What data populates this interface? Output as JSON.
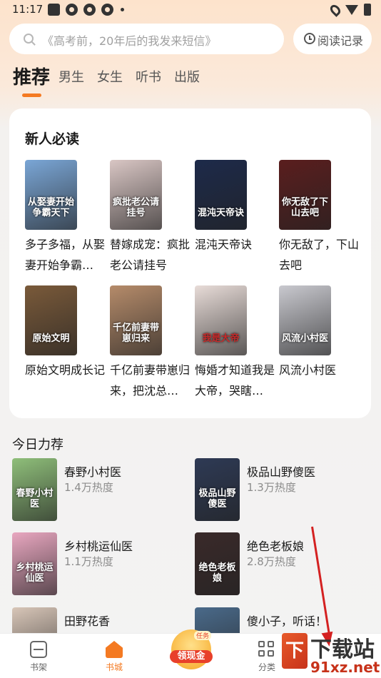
{
  "status_bar": {
    "time": "11:17"
  },
  "search": {
    "placeholder": "《高考前，20年后的我发来短信》"
  },
  "history": {
    "label": "阅读记录"
  },
  "tabs": [
    {
      "label": "推荐"
    },
    {
      "label": "男生"
    },
    {
      "label": "女生"
    },
    {
      "label": "听书"
    },
    {
      "label": "出版"
    }
  ],
  "new_readers": {
    "title": "新人必读",
    "books": [
      {
        "title": "多子多福，从娶妻开始争霸天下",
        "title_display": "多子多福，从娶妻开始争霸…",
        "cover_text": "从娶妻开始争霸天下",
        "color": "#7aa6d6"
      },
      {
        "title": "替嫁成宠：疯批老公请挂号",
        "title_display": "替嫁成宠：疯批老公请挂号",
        "cover_text": "疯批老公请挂号",
        "color": "#d9c6c4"
      },
      {
        "title": "混沌天帝诀",
        "title_display": "混沌天帝诀",
        "cover_text": "混沌天帝诀",
        "color": "#1d2a4a"
      },
      {
        "title": "你无敌了，下山去吧",
        "title_display": "你无敌了，下山去吧",
        "cover_text": "你无敌了下山去吧",
        "color": "#5a1e1e"
      },
      {
        "title": "原始文明成长记",
        "title_display": "原始文明成长记",
        "cover_text": "原始文明",
        "color": "#7a5a3a"
      },
      {
        "title": "千亿前妻带崽归来，把沈总…",
        "title_display": "千亿前妻带崽归来，把沈总…",
        "cover_text": "千亿前妻带崽归来",
        "color": "#b58b6a"
      },
      {
        "title": "悔婚才知道我是大帝，哭瞎…",
        "title_display": "悔婚才知道我是大帝，哭瞎…",
        "cover_text": "我是大帝",
        "color": "#e8dcd8"
      },
      {
        "title": "风流小村医",
        "title_display": "风流小村医",
        "cover_text": "风流小村医",
        "color": "#c9c9cf"
      }
    ]
  },
  "recommend": {
    "title": "今日力荐",
    "items": [
      {
        "name": "春野小村医",
        "heat": "1.4万热度",
        "cover_text": "春野小村医",
        "color": "#8fbf7a"
      },
      {
        "name": "极品山野傻医",
        "heat": "1.3万热度",
        "cover_text": "极品山野傻医",
        "color": "#2e3a55"
      },
      {
        "name": "乡村桃运仙医",
        "heat": "1.1万热度",
        "cover_text": "乡村桃运仙医",
        "color": "#e9a7c0"
      },
      {
        "name": "绝色老板娘",
        "heat": "2.8万热度",
        "cover_text": "绝色老板娘",
        "color": "#3a2a2a"
      },
      {
        "name": "田野花香",
        "heat": "",
        "cover_text": "",
        "color": "#d8c6b8"
      },
      {
        "name": "傻小子，听话！",
        "heat": "",
        "cover_text": "",
        "color": "#4a6a8a"
      }
    ]
  },
  "bottom_nav": {
    "shelf": "书架",
    "store": "书城",
    "coin": "领现金",
    "coin_tag": "任务",
    "category": "分类"
  },
  "watermark": {
    "logo": "下",
    "line1": "下载站",
    "line2": "91xz.net"
  },
  "colors": {
    "accent": "#f47a22",
    "annotation": "#d42121"
  }
}
